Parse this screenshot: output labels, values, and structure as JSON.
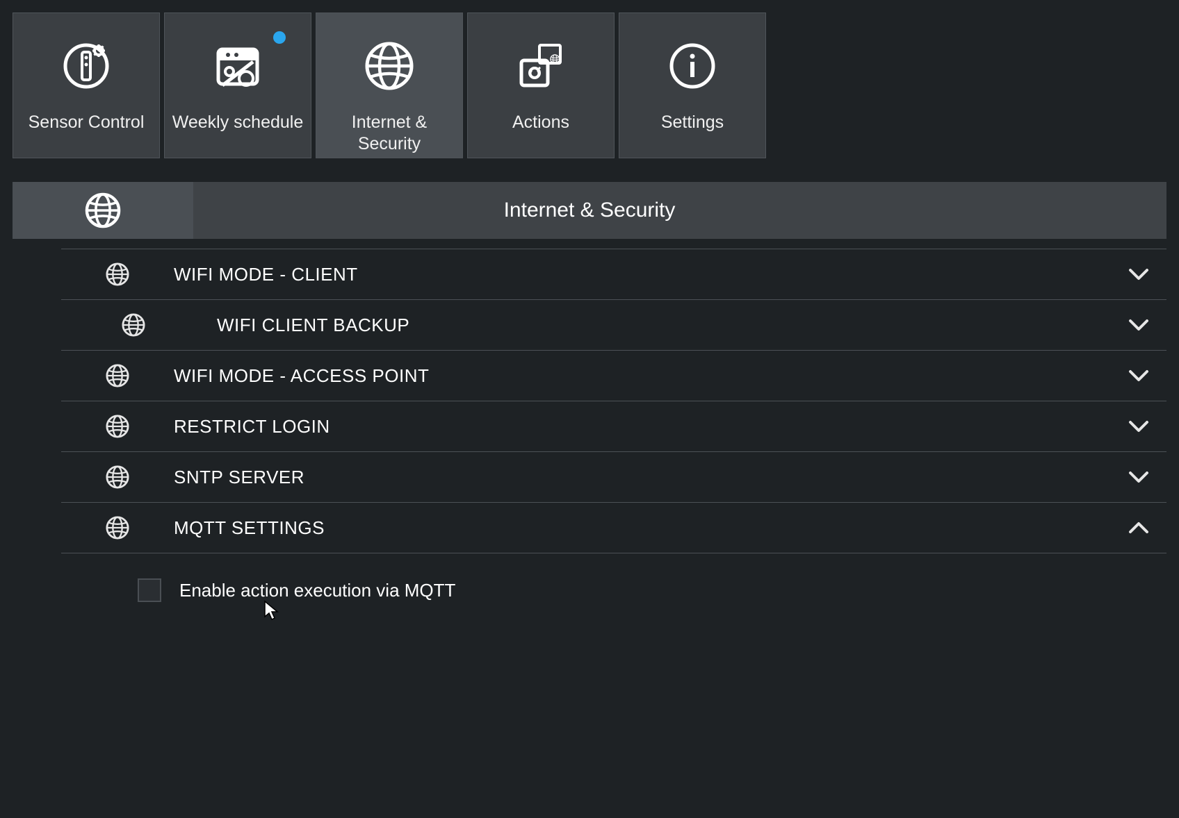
{
  "tabs": [
    {
      "label": "Sensor Control"
    },
    {
      "label": "Weekly schedule"
    },
    {
      "label": "Internet & Security"
    },
    {
      "label": "Actions"
    },
    {
      "label": "Settings"
    }
  ],
  "section": {
    "title": "Internet & Security"
  },
  "rows": {
    "wifi_client": "WIFI MODE - CLIENT",
    "wifi_backup": "WIFI CLIENT BACKUP",
    "wifi_ap": "WIFI MODE - ACCESS POINT",
    "restrict": "RESTRICT LOGIN",
    "sntp": "SNTP SERVER",
    "mqtt": "MQTT SETTINGS"
  },
  "mqtt": {
    "enable_label": "Enable action execution via MQTT"
  }
}
